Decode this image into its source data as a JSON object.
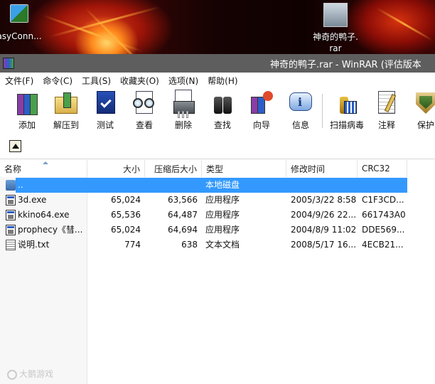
{
  "desktop": {
    "icons": [
      {
        "label": "asyConn..."
      },
      {
        "label_line1": "神奇的鸭子.",
        "label_line2": "rar"
      }
    ]
  },
  "window": {
    "title": "神奇的鸭子.rar - WinRAR (评估版本"
  },
  "menu": {
    "items": [
      "文件(F)",
      "命令(C)",
      "工具(S)",
      "收藏夹(O)",
      "选项(N)",
      "帮助(H)"
    ]
  },
  "toolbar": {
    "buttons": [
      "添加",
      "解压到",
      "测试",
      "查看",
      "删除",
      "查找",
      "向导",
      "信息",
      "扫描病毒",
      "注释",
      "保护"
    ]
  },
  "list": {
    "columns": [
      "名称",
      "大小",
      "压缩后大小",
      "类型",
      "修改时间",
      "CRC32"
    ],
    "rows": [
      {
        "name": "..",
        "size": "",
        "packed": "",
        "type": "本地磁盘",
        "modified": "",
        "crc": "",
        "icon": "updir-icon",
        "selected": true
      },
      {
        "name": "3d.exe",
        "size": "65,024",
        "packed": "63,566",
        "type": "应用程序",
        "modified": "2005/3/22 8:58",
        "crc": "C1F3CD...",
        "icon": "exe-file-icon",
        "selected": false
      },
      {
        "name": "kkino64.exe",
        "size": "65,536",
        "packed": "64,487",
        "type": "应用程序",
        "modified": "2004/9/26 22...",
        "crc": "661743A0",
        "icon": "exe-file-icon",
        "selected": false
      },
      {
        "name": "prophecy《彗...",
        "size": "65,024",
        "packed": "64,694",
        "type": "应用程序",
        "modified": "2004/8/9 11:02",
        "crc": "DDE569...",
        "icon": "exe-file-icon",
        "selected": false
      },
      {
        "name": "说明.txt",
        "size": "774",
        "packed": "638",
        "type": "文本文档",
        "modified": "2008/5/17 16...",
        "crc": "4ECB21...",
        "icon": "txt-file-icon",
        "selected": false
      }
    ]
  },
  "watermark": {
    "text": "大鹅游戏"
  },
  "colors": {
    "selection": "#3399ff",
    "titlebar": "#5e5e5e"
  }
}
